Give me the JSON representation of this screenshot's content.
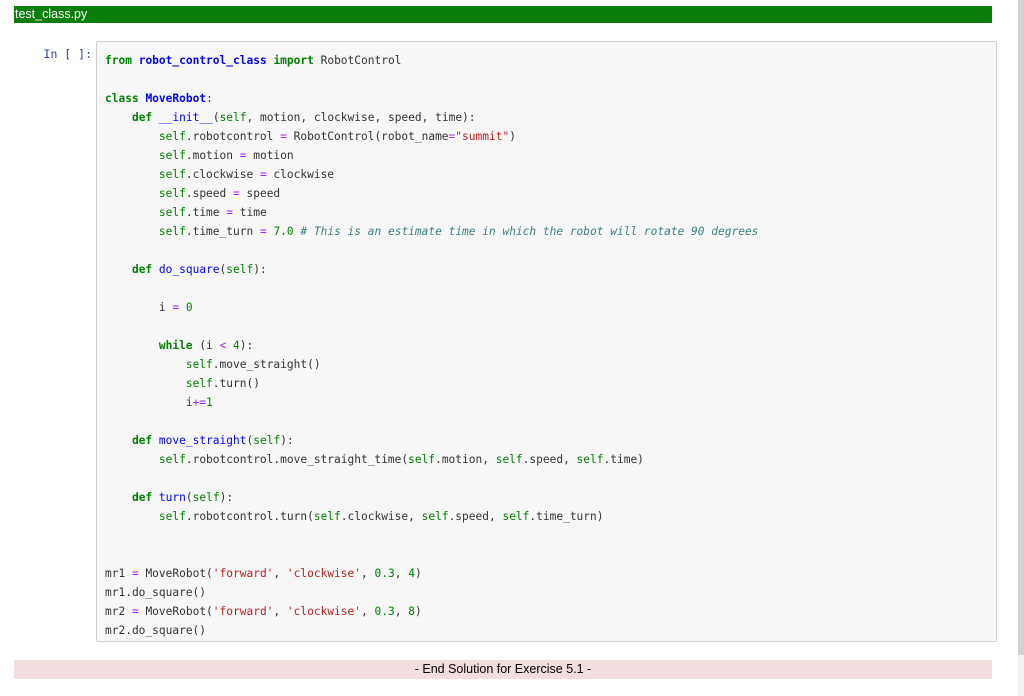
{
  "header": {
    "filename": "test_class.py",
    "bar_color": "#0a7d0a"
  },
  "cell": {
    "prompt": "In [ ]:",
    "lines": [
      [
        [
          "kw",
          "from"
        ],
        [
          "plain",
          " "
        ],
        [
          "mod",
          "robot_control_class"
        ],
        [
          "plain",
          " "
        ],
        [
          "kw",
          "import"
        ],
        [
          "plain",
          " RobotControl"
        ]
      ],
      [],
      [
        [
          "kw",
          "class"
        ],
        [
          "plain",
          " "
        ],
        [
          "cls",
          "MoveRobot"
        ],
        [
          "plain",
          ":"
        ]
      ],
      [
        [
          "plain",
          "    "
        ],
        [
          "kw",
          "def"
        ],
        [
          "plain",
          " "
        ],
        [
          "fn",
          "__init__"
        ],
        [
          "plain",
          "("
        ],
        [
          "self",
          "self"
        ],
        [
          "plain",
          ", motion, clockwise, speed, time):"
        ]
      ],
      [
        [
          "plain",
          "        "
        ],
        [
          "self",
          "self"
        ],
        [
          "plain",
          ".robotcontrol "
        ],
        [
          "op",
          "="
        ],
        [
          "plain",
          " RobotControl(robot_name"
        ],
        [
          "op",
          "="
        ],
        [
          "str",
          "\"summit\""
        ],
        [
          "plain",
          ")"
        ]
      ],
      [
        [
          "plain",
          "        "
        ],
        [
          "self",
          "self"
        ],
        [
          "plain",
          ".motion "
        ],
        [
          "op",
          "="
        ],
        [
          "plain",
          " motion"
        ]
      ],
      [
        [
          "plain",
          "        "
        ],
        [
          "self",
          "self"
        ],
        [
          "plain",
          ".clockwise "
        ],
        [
          "op",
          "="
        ],
        [
          "plain",
          " clockwise"
        ]
      ],
      [
        [
          "plain",
          "        "
        ],
        [
          "self",
          "self"
        ],
        [
          "plain",
          ".speed "
        ],
        [
          "op",
          "="
        ],
        [
          "plain",
          " speed"
        ]
      ],
      [
        [
          "plain",
          "        "
        ],
        [
          "self",
          "self"
        ],
        [
          "plain",
          ".time "
        ],
        [
          "op",
          "="
        ],
        [
          "plain",
          " time"
        ]
      ],
      [
        [
          "plain",
          "        "
        ],
        [
          "self",
          "self"
        ],
        [
          "plain",
          ".time_turn "
        ],
        [
          "op",
          "="
        ],
        [
          "plain",
          " "
        ],
        [
          "num",
          "7.0"
        ],
        [
          "plain",
          " "
        ],
        [
          "cmt",
          "# This is an estimate time in which the robot will rotate 90 degrees"
        ]
      ],
      [],
      [
        [
          "plain",
          "    "
        ],
        [
          "kw",
          "def"
        ],
        [
          "plain",
          " "
        ],
        [
          "fn",
          "do_square"
        ],
        [
          "plain",
          "("
        ],
        [
          "self",
          "self"
        ],
        [
          "plain",
          "):"
        ]
      ],
      [],
      [
        [
          "plain",
          "        i "
        ],
        [
          "op",
          "="
        ],
        [
          "plain",
          " "
        ],
        [
          "num",
          "0"
        ]
      ],
      [],
      [
        [
          "plain",
          "        "
        ],
        [
          "kw",
          "while"
        ],
        [
          "plain",
          " (i "
        ],
        [
          "op",
          "<"
        ],
        [
          "plain",
          " "
        ],
        [
          "num",
          "4"
        ],
        [
          "plain",
          "):"
        ]
      ],
      [
        [
          "plain",
          "            "
        ],
        [
          "self",
          "self"
        ],
        [
          "plain",
          ".move_straight()"
        ]
      ],
      [
        [
          "plain",
          "            "
        ],
        [
          "self",
          "self"
        ],
        [
          "plain",
          ".turn()"
        ]
      ],
      [
        [
          "plain",
          "            i"
        ],
        [
          "op",
          "+="
        ],
        [
          "num",
          "1"
        ]
      ],
      [],
      [
        [
          "plain",
          "    "
        ],
        [
          "kw",
          "def"
        ],
        [
          "plain",
          " "
        ],
        [
          "fn",
          "move_straight"
        ],
        [
          "plain",
          "("
        ],
        [
          "self",
          "self"
        ],
        [
          "plain",
          "):"
        ]
      ],
      [
        [
          "plain",
          "        "
        ],
        [
          "self",
          "self"
        ],
        [
          "plain",
          ".robotcontrol.move_straight_time("
        ],
        [
          "self",
          "self"
        ],
        [
          "plain",
          ".motion, "
        ],
        [
          "self",
          "self"
        ],
        [
          "plain",
          ".speed, "
        ],
        [
          "self",
          "self"
        ],
        [
          "plain",
          ".time)"
        ]
      ],
      [],
      [
        [
          "plain",
          "    "
        ],
        [
          "kw",
          "def"
        ],
        [
          "plain",
          " "
        ],
        [
          "fn",
          "turn"
        ],
        [
          "plain",
          "("
        ],
        [
          "self",
          "self"
        ],
        [
          "plain",
          "):"
        ]
      ],
      [
        [
          "plain",
          "        "
        ],
        [
          "self",
          "self"
        ],
        [
          "plain",
          ".robotcontrol.turn("
        ],
        [
          "self",
          "self"
        ],
        [
          "plain",
          ".clockwise, "
        ],
        [
          "self",
          "self"
        ],
        [
          "plain",
          ".speed, "
        ],
        [
          "self",
          "self"
        ],
        [
          "plain",
          ".time_turn)"
        ]
      ],
      [],
      [],
      [
        [
          "plain",
          "mr1 "
        ],
        [
          "op",
          "="
        ],
        [
          "plain",
          " MoveRobot("
        ],
        [
          "str",
          "'forward'"
        ],
        [
          "plain",
          ", "
        ],
        [
          "str",
          "'clockwise'"
        ],
        [
          "plain",
          ", "
        ],
        [
          "num",
          "0.3"
        ],
        [
          "plain",
          ", "
        ],
        [
          "num",
          "4"
        ],
        [
          "plain",
          ")"
        ]
      ],
      [
        [
          "plain",
          "mr1.do_square()"
        ]
      ],
      [
        [
          "plain",
          "mr2 "
        ],
        [
          "op",
          "="
        ],
        [
          "plain",
          " MoveRobot("
        ],
        [
          "str",
          "'forward'"
        ],
        [
          "plain",
          ", "
        ],
        [
          "str",
          "'clockwise'"
        ],
        [
          "plain",
          ", "
        ],
        [
          "num",
          "0.3"
        ],
        [
          "plain",
          ", "
        ],
        [
          "num",
          "8"
        ],
        [
          "plain",
          ")"
        ]
      ],
      [
        [
          "plain",
          "mr2.do_square()"
        ]
      ]
    ]
  },
  "footer": {
    "text": "- End Solution for Exercise 5.1 -",
    "bar_color": "#f2dede"
  }
}
